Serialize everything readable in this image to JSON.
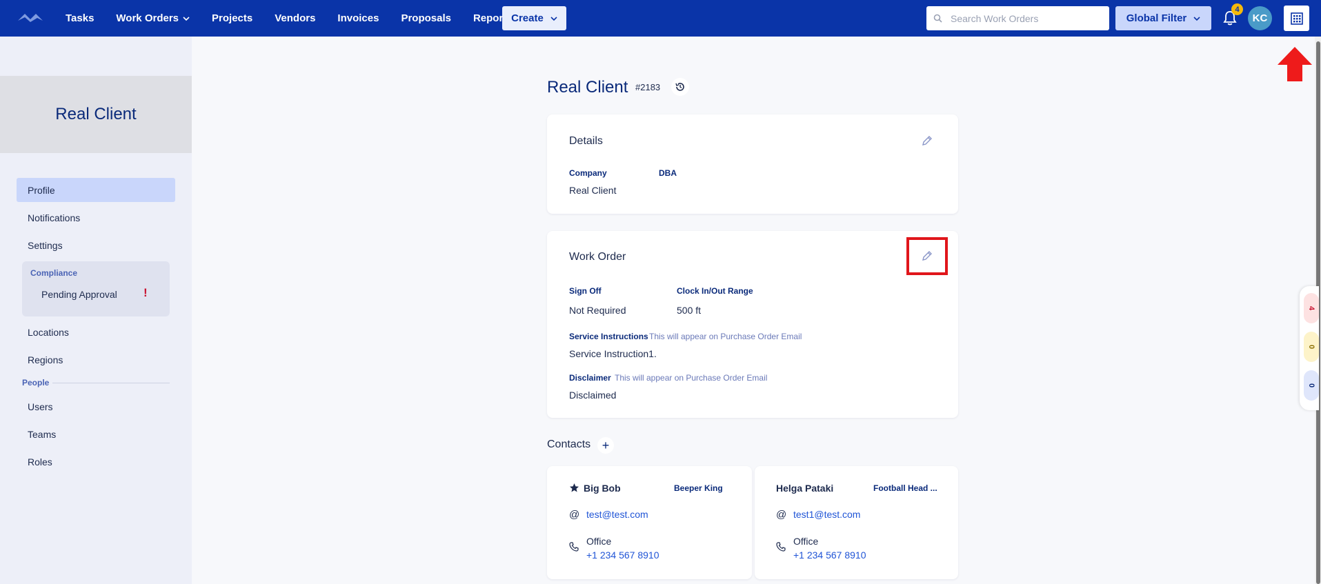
{
  "nav": {
    "items": [
      {
        "label": "Tasks",
        "has_dropdown": false
      },
      {
        "label": "Work Orders",
        "has_dropdown": true
      },
      {
        "label": "Projects",
        "has_dropdown": false
      },
      {
        "label": "Vendors",
        "has_dropdown": false
      },
      {
        "label": "Invoices",
        "has_dropdown": false
      },
      {
        "label": "Proposals",
        "has_dropdown": false
      },
      {
        "label": "Reports",
        "has_dropdown": false
      }
    ],
    "create_label": "Create",
    "search_placeholder": "Search Work Orders",
    "global_filter_label": "Global Filter",
    "notification_count": "4",
    "avatar_initials": "KC",
    "bg_color": "#0a34a8"
  },
  "sidebar": {
    "title": "Real Client",
    "items": [
      {
        "label": "Profile",
        "active": true
      },
      {
        "label": "Notifications",
        "active": false
      },
      {
        "label": "Settings",
        "active": false
      }
    ],
    "compliance": {
      "label": "Compliance",
      "pending_label": "Pending Approval",
      "alert": "!"
    },
    "items2": [
      {
        "label": "Locations"
      },
      {
        "label": "Regions"
      }
    ],
    "people_label": "People",
    "people_items": [
      {
        "label": "Users"
      },
      {
        "label": "Teams"
      },
      {
        "label": "Roles"
      }
    ]
  },
  "main": {
    "title": "Real Client",
    "number": "#2183",
    "details": {
      "title": "Details",
      "company_label": "Company",
      "company_value": "Real Client",
      "dba_label": "DBA"
    },
    "work_order": {
      "title": "Work Order",
      "sign_off_label": "Sign Off",
      "sign_off_value": "Not Required",
      "clock_label": "Clock In/Out Range",
      "clock_value": "500 ft",
      "service_label": "Service Instructions",
      "service_hint": "This will appear on Purchase Order Email",
      "service_value": "Service Instruction1.",
      "disclaimer_label": "Disclaimer",
      "disclaimer_hint": "This will appear on Purchase Order Email",
      "disclaimer_value": "Disclaimed"
    },
    "contacts": {
      "title": "Contacts",
      "add": "+",
      "items": [
        {
          "name": "Big Bob",
          "role": "Beeper King",
          "email": "test@test.com",
          "office_label": "Office",
          "phone": "+1 234 567 8910",
          "starred": true
        },
        {
          "name": "Helga Pataki",
          "role": "Football Head ...",
          "email": "test1@test.com",
          "office_label": "Office",
          "phone": "+1 234 567 8910",
          "starred": false
        }
      ]
    }
  },
  "side_pills": [
    {
      "value": "4",
      "bg": "#fde2e2",
      "color": "#c8102e"
    },
    {
      "value": "0",
      "bg": "#fdf3c9",
      "color": "#8a6d00"
    },
    {
      "value": "0",
      "bg": "#dfe6fb",
      "color": "#0a2a7a"
    }
  ]
}
